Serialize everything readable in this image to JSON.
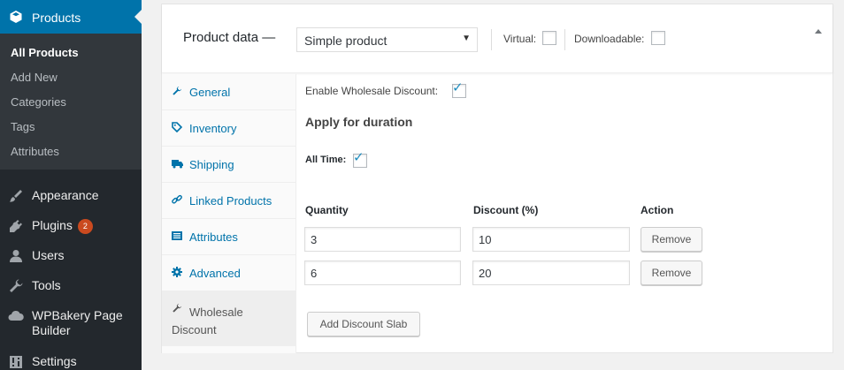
{
  "sidebar": {
    "current_menu": {
      "label": "Products",
      "icon": "box-icon"
    },
    "submenu": [
      {
        "label": "All Products",
        "current": true
      },
      {
        "label": "Add New"
      },
      {
        "label": "Categories"
      },
      {
        "label": "Tags"
      },
      {
        "label": "Attributes"
      }
    ],
    "items": [
      {
        "label": "Appearance",
        "icon": "brush-icon"
      },
      {
        "label": "Plugins",
        "icon": "plug-icon",
        "badge": "2"
      },
      {
        "label": "Users",
        "icon": "user-icon"
      },
      {
        "label": "Tools",
        "icon": "wrench-icon"
      },
      {
        "label": "WPBakery Page Builder",
        "icon": "cloud-icon",
        "line1": "WPBakery Page",
        "line2": "Builder"
      },
      {
        "label": "Settings",
        "icon": "sliders-icon"
      }
    ]
  },
  "product_data": {
    "title": "Product data —",
    "type_select": "Simple product",
    "virtual_label": "Virtual:",
    "downloadable_label": "Downloadable:",
    "virtual_checked": false,
    "downloadable_checked": false
  },
  "tabs": [
    {
      "label": "General",
      "icon": "wrench-icon"
    },
    {
      "label": "Inventory",
      "icon": "tag-icon"
    },
    {
      "label": "Shipping",
      "icon": "truck-icon"
    },
    {
      "label": "Linked Products",
      "icon": "link-icon"
    },
    {
      "label": "Attributes",
      "icon": "list-icon"
    },
    {
      "label": "Advanced",
      "icon": "gear-icon"
    },
    {
      "label": "Wholesale Discount",
      "icon": "wrench-icon",
      "line1": "Wholesale",
      "line2": "Discount",
      "active": true
    }
  ],
  "wholesale": {
    "enable_label": "Enable Wholesale Discount:",
    "enable_checked": true,
    "duration_title": "Apply for duration",
    "all_time_label": "All Time:",
    "all_time_checked": true,
    "columns": [
      "Quantity",
      "Discount (%)",
      "Action"
    ],
    "rows": [
      {
        "quantity": "3",
        "discount": "10",
        "action": "Remove"
      },
      {
        "quantity": "6",
        "discount": "20",
        "action": "Remove"
      }
    ],
    "add_button": "Add Discount Slab"
  },
  "colors": {
    "sidebar_bg": "#23282d",
    "submenu_bg": "#32373c",
    "accent": "#0073aa",
    "badge": "#ca4a1f",
    "link": "#0073aa"
  }
}
